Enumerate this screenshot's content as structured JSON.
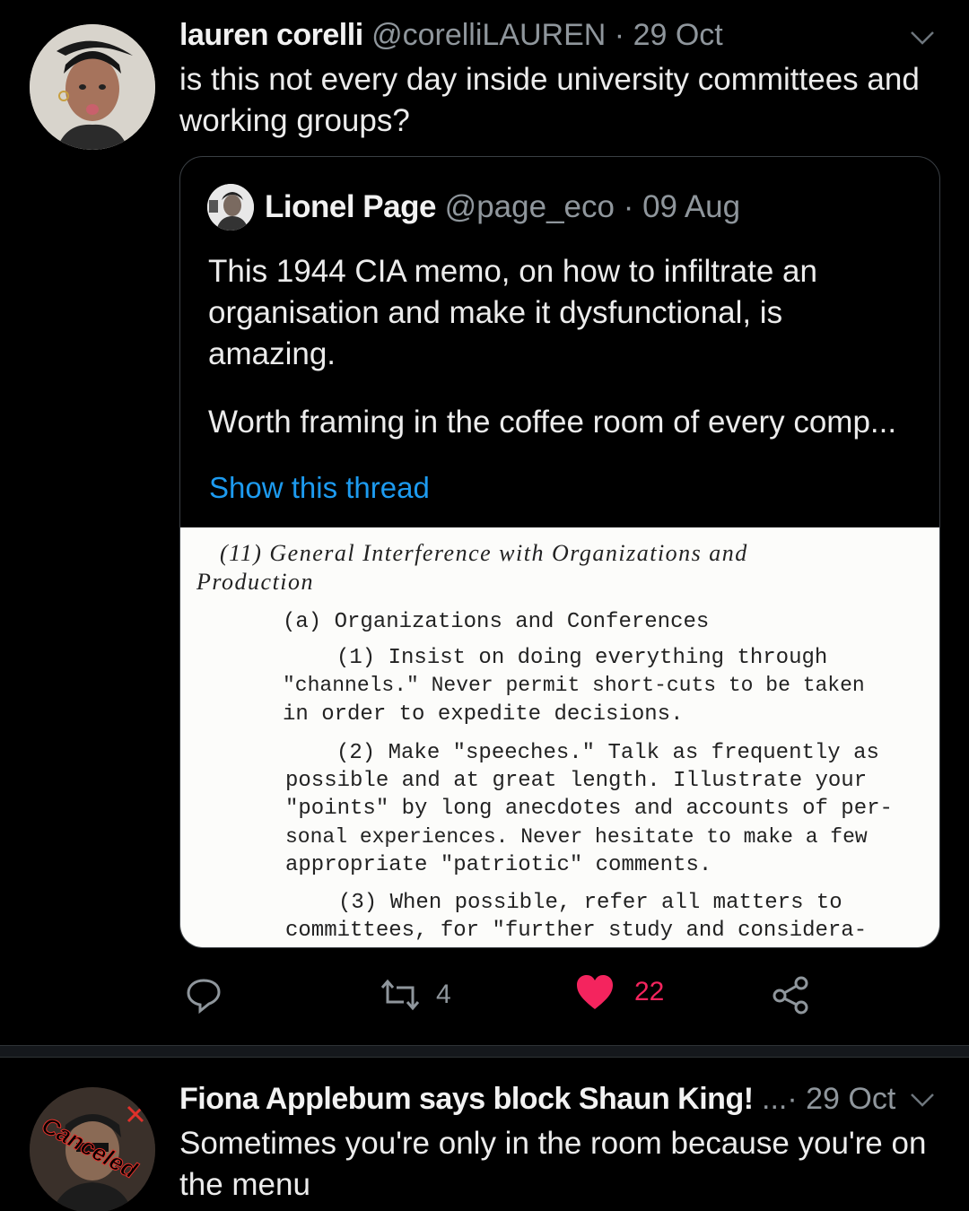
{
  "tweet1": {
    "name": "lauren corelli",
    "handle": "@corelliLAUREN",
    "dot": "·",
    "date": "29 Oct",
    "text_line1": "is this not every day inside university committees and",
    "text_line2": "working groups?",
    "quote": {
      "name": "Lionel Page",
      "handle": "@page_eco",
      "dot": "·",
      "date": "09 Aug",
      "text_line1": "This 1944 CIA memo, on how to infiltrate an",
      "text_line2": "organisation and make it dysfunctional, is",
      "text_line3": "amazing.",
      "text_line4": "Worth framing in the coffee room of every comp...",
      "show_thread": "Show this thread",
      "memo": {
        "l1": "(11) General Interference with Organizations and",
        "l2": "Production",
        "l3": "(a) Organizations and Conferences",
        "l4": "(1) Insist on doing everything through",
        "l5": "\"channels.\" Never permit short-cuts to be taken",
        "l6": "in order to expedite decisions.",
        "l7": "(2) Make \"speeches.\" Talk as frequently as",
        "l8": "possible and at great length. Illustrate your",
        "l9": "\"points\" by long anecdotes and accounts of per-",
        "l10": "sonal experiences. Never hesitate to make a few",
        "l11": "appropriate \"patriotic\" comments.",
        "l12": "(3) When possible, refer all matters to",
        "l13": "committees, for \"further study and considera-"
      }
    },
    "actions": {
      "retweets": "4",
      "likes": "22"
    },
    "colors": {
      "like": "#f4245e",
      "link": "#1d9bf0",
      "secondary": "#8f969c"
    }
  },
  "tweet2": {
    "name": "Fiona Applebum says block Shaun King!",
    "ellipsis": "...",
    "dot": "·",
    "date": "29 Oct",
    "avatar_sticker": "Canceled",
    "text_line1": "Sometimes you're only in the room because you're on",
    "text_line2": "the menu"
  }
}
